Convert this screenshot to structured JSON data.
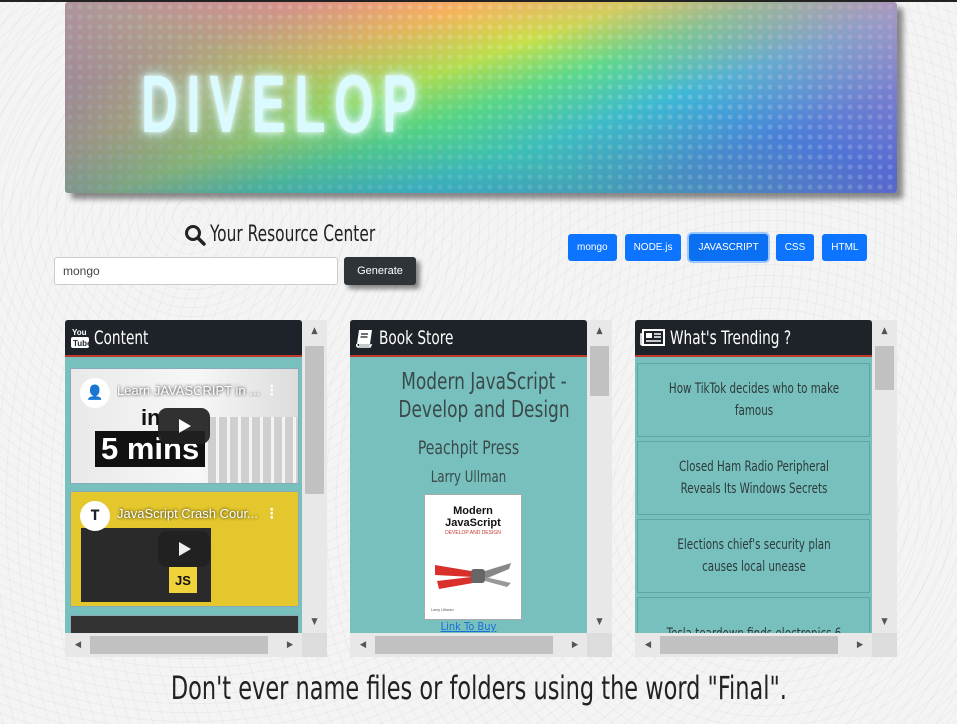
{
  "banner": {
    "logo_text": "DIVELOP"
  },
  "resource": {
    "title": "Your Resource Center",
    "search_value": "mongo",
    "generate_label": "Generate"
  },
  "topics": [
    "mongo",
    "NODE.js",
    "JAVASCRIPT",
    "CSS",
    "HTML"
  ],
  "active_topic": "JAVASCRIPT",
  "content_panel": {
    "title": "Content",
    "icon": "youtube-icon",
    "videos": [
      {
        "title": "Learn JAVASCRIPT in ...",
        "thumb_line1": "in",
        "thumb_line2": "5 mins"
      },
      {
        "title": "JavaScript Crash Cour...",
        "thumb_badge": "JS"
      }
    ]
  },
  "book_panel": {
    "title": "Book Store",
    "icon": "book-icon",
    "book": {
      "title": "Modern JavaScript - Develop and Design",
      "publisher": "Peachpit Press",
      "author": "Larry Ullman",
      "cover_title": "Modern JavaScript",
      "cover_subtitle": "DEVELOP AND DESIGN",
      "cover_author": "Larry Ullman",
      "link_label": "Link To Buy"
    }
  },
  "trending_panel": {
    "title": "What's Trending ?",
    "icon": "newspaper-icon",
    "items": [
      "How TikTok decides who to make famous",
      "Closed Ham Radio Peripheral Reveals Its Windows Secrets",
      "Elections chief's security plan causes local unease",
      "Tesla teardown finds electronics 6"
    ]
  },
  "footer": {
    "quote": "Don't ever name files or folders using the word \"Final\"."
  },
  "colors": {
    "topic_button": "#0d74ff",
    "panel_header": "#1d2329",
    "panel_body": "#77c0be",
    "header_underline": "#c0392b"
  }
}
